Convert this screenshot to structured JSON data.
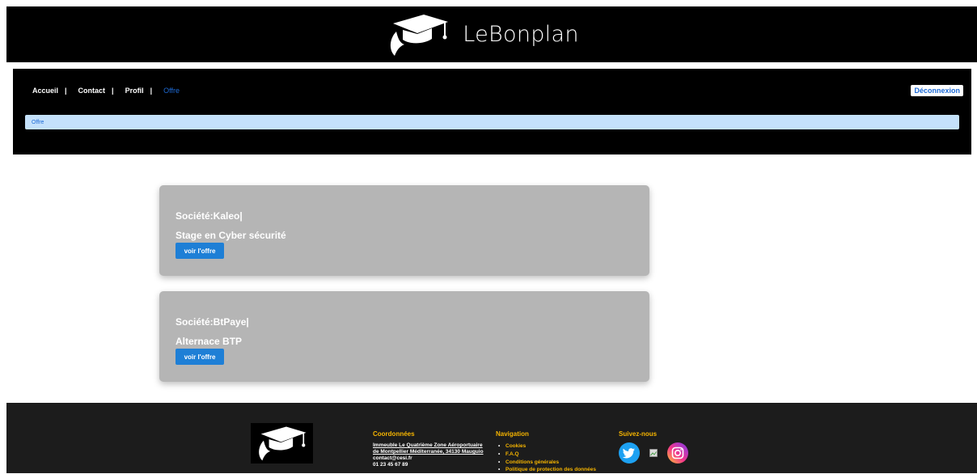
{
  "header": {
    "brand": "LeBonplan",
    "logo_icon": "graduation-cap-icon"
  },
  "nav": {
    "items": [
      {
        "label": "Accueil",
        "sep": "|"
      },
      {
        "label": "Contact",
        "sep": "|"
      },
      {
        "label": "Profil",
        "sep": "|"
      },
      {
        "label": "Offre",
        "sep": ""
      }
    ],
    "logout_label": "Déconnexion"
  },
  "breadcrumb": {
    "label": "Offre"
  },
  "offers": [
    {
      "company": "Société:Kaleo|",
      "title": "Stage en Cyber sécurité",
      "button": "voir l'offre"
    },
    {
      "company": "Société:BtPaye|",
      "title": "Alternace BTP",
      "button": "voir l'offre"
    }
  ],
  "footer": {
    "coords": {
      "heading": "Coordonnées",
      "address_line1": "Immeuble Le Quatrième Zone Aéroportuaire",
      "address_line2": "de Montpellier Méditerranée, 34130 Mauguio",
      "email": "contact@cesi.fr",
      "phone": "01 23 45 67 89"
    },
    "navigation": {
      "heading": "Navigation",
      "items": [
        "Cookies",
        "F.A.Q",
        "Conditions générales",
        "Politique de protection des données"
      ]
    },
    "social": {
      "heading": "Suivez-nous",
      "icons": [
        "twitter-icon",
        "broken-image-icon",
        "instagram-icon"
      ]
    }
  },
  "colors": {
    "accent": "#1e6bd6",
    "button": "#1e7fd6",
    "card_bg": "#b5b5b5",
    "footer_heading": "#f5b400",
    "breadcrumb_bg": "#c4e1fb"
  }
}
